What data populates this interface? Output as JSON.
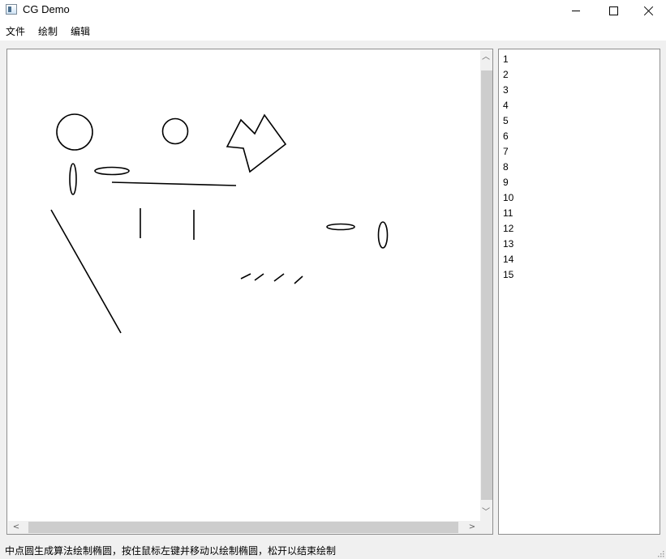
{
  "window": {
    "title": "CG Demo",
    "controls": {
      "minimize": "minimize",
      "maximize": "maximize",
      "close": "close"
    }
  },
  "menubar": {
    "items": [
      {
        "label": "文件"
      },
      {
        "label": "绘制"
      },
      {
        "label": "编辑"
      }
    ]
  },
  "canvas": {
    "background": "#ffffff",
    "stroke_color": "#000000"
  },
  "item_list": {
    "items": [
      "1",
      "2",
      "3",
      "4",
      "5",
      "6",
      "7",
      "8",
      "9",
      "10",
      "11",
      "12",
      "13",
      "14",
      "15"
    ]
  },
  "statusbar": {
    "text": "中点圆生成算法绘制椭圆，按住鼠标左键并移动以绘制椭圆，松开以结束绘制"
  }
}
